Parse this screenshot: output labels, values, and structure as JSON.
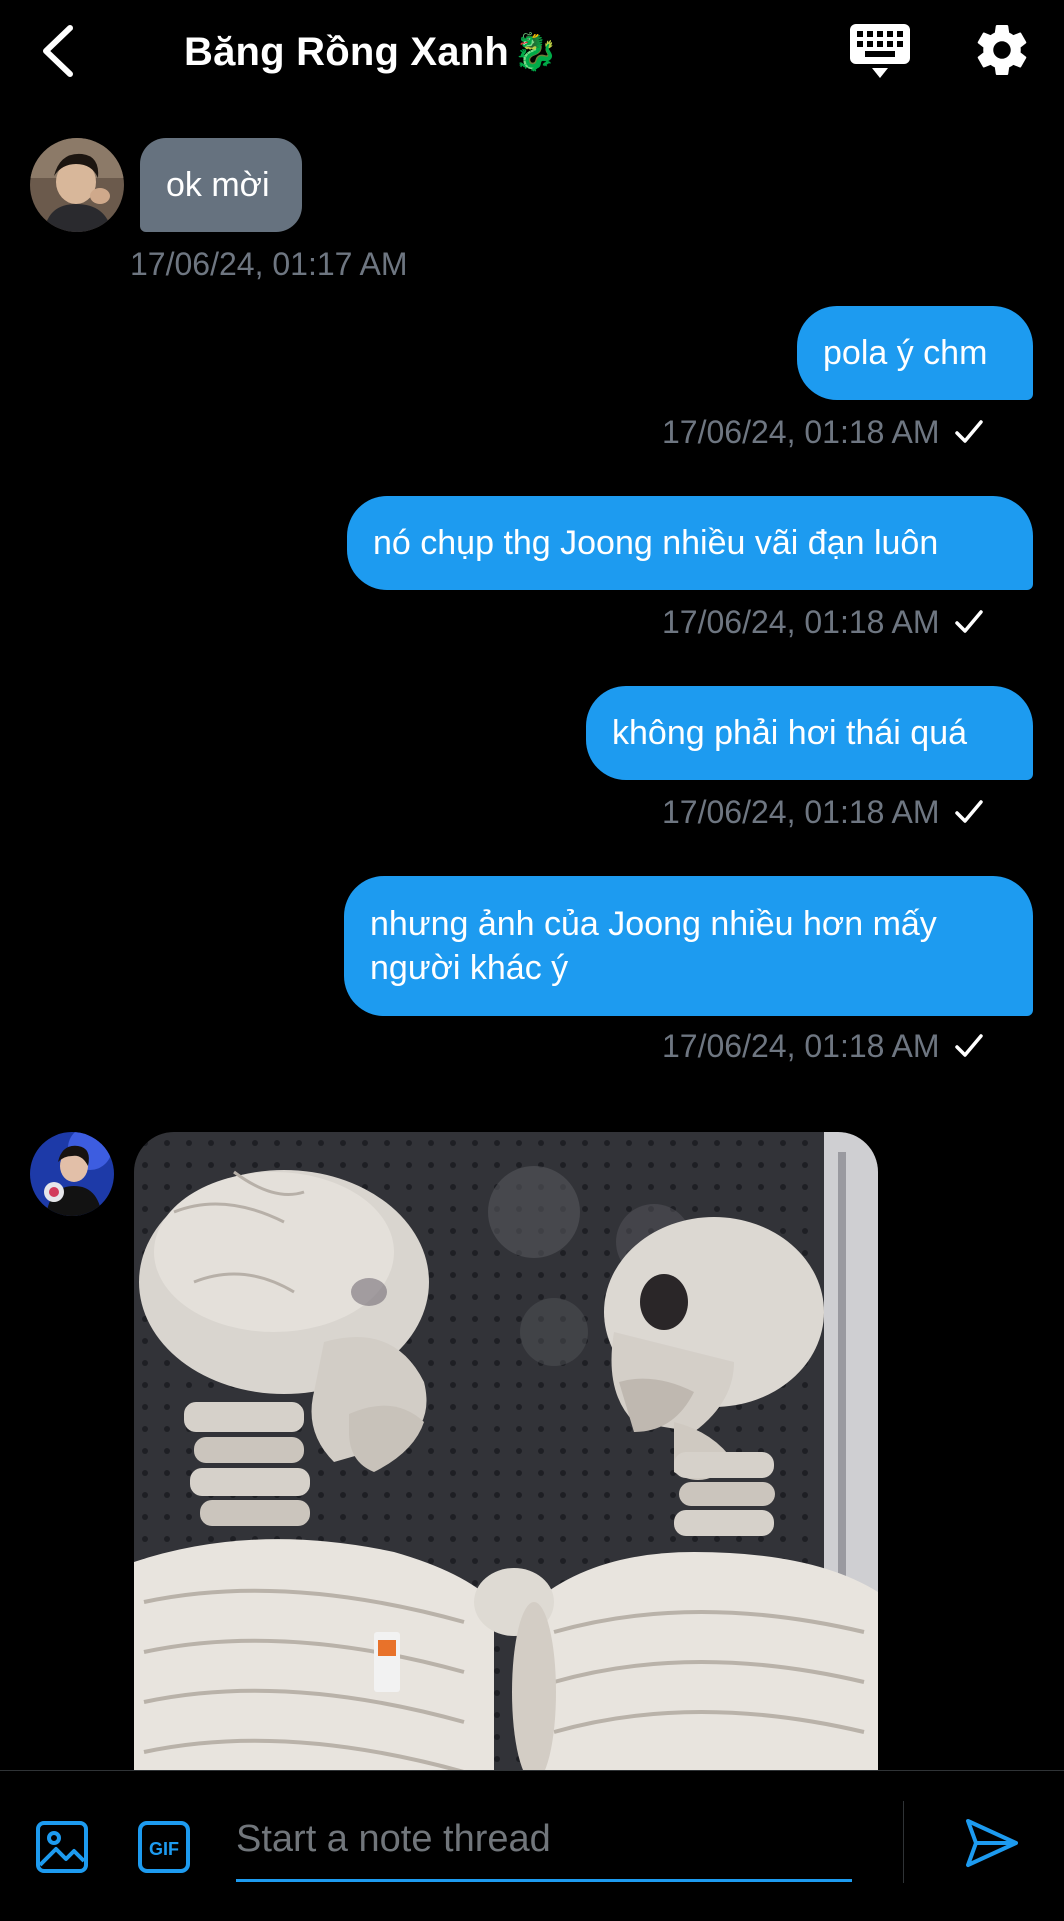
{
  "header": {
    "title": "Băng Rồng Xanh",
    "title_emoji": "🐉",
    "icons": [
      "back-icon",
      "keyboard-icon",
      "gear-icon"
    ]
  },
  "messages": [
    {
      "direction": "in",
      "text": "ok mời",
      "timestamp": "17/06/24, 01:17 AM",
      "read": false
    },
    {
      "direction": "out",
      "text": "pola ý chm",
      "timestamp": "17/06/24, 01:18 AM",
      "read": true
    },
    {
      "direction": "out",
      "text": "nó chụp thg Joong nhiều vãi đạn luôn",
      "timestamp": "17/06/24, 01:18 AM",
      "read": true
    },
    {
      "direction": "out",
      "text": "không phải hơi thái quá",
      "timestamp": "17/06/24, 01:18 AM",
      "read": true
    },
    {
      "direction": "out",
      "text": "nhưng ảnh của Joong nhiều hơn mấy người khác ý",
      "timestamp": "17/06/24, 01:18 AM",
      "read": true
    },
    {
      "direction": "in",
      "type": "image",
      "image_description": "two-skeletons-meme"
    }
  ],
  "composer": {
    "placeholder": "Start a note thread",
    "icons": [
      "image-icon",
      "gif-icon",
      "send-icon"
    ],
    "gif_label": "GIF"
  },
  "colors": {
    "background": "#000000",
    "accent": "#1d9bf0",
    "incoming_bubble": "#66727f",
    "timestamp": "#6e7681"
  }
}
